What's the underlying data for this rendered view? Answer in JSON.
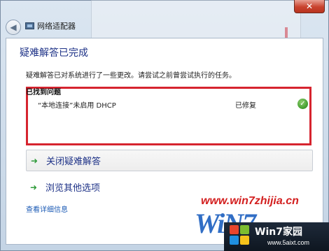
{
  "window": {
    "title": "网络适配器",
    "close_glyph": "✕",
    "back_glyph": "◀"
  },
  "main": {
    "heading": "疑难解答已完成",
    "description": "疑难解答已对系统进行了一些更改。请尝试之前曾尝试执行的任务。",
    "problems": {
      "title": "已找到问题",
      "items": [
        {
          "name": "“本地连接”未启用 DHCP",
          "status": "已修复",
          "status_icon": "check-icon"
        }
      ]
    },
    "options": [
      {
        "label": "关闭疑难解答",
        "icon": "green-arrow-icon"
      },
      {
        "label": "浏览其他选项",
        "icon": "green-arrow-icon"
      }
    ],
    "detail_link": "查看详细信息"
  },
  "watermark": {
    "url_text": "www.win7zhijia.cn",
    "logo_text": "WiN7"
  },
  "badge": {
    "title": "Win7家园",
    "url": "www.5aixt.com"
  },
  "colors": {
    "heading": "#1e3287",
    "highlight_border": "#d6242f",
    "check": "#3f9a2c",
    "link": "#1c5bb5",
    "watermark": "#d32020"
  }
}
